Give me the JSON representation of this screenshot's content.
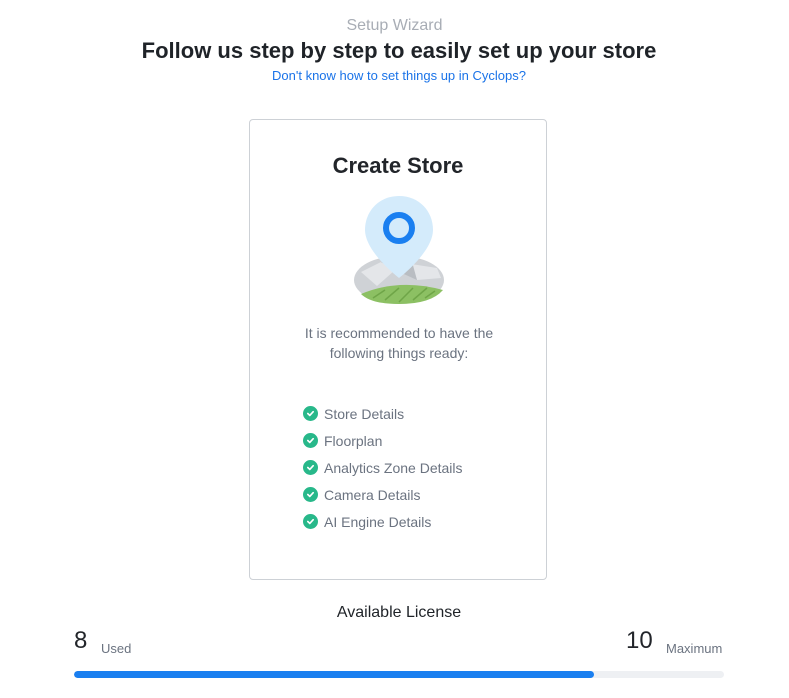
{
  "header": {
    "wizard_label": "Setup Wizard",
    "title": "Follow us step by step to easily set up your store",
    "help_link": "Don't know how to set things up in Cyclops?"
  },
  "card": {
    "title": "Create Store",
    "illustration_icon": "map-pin-icon",
    "recommendation": "It is recommended to have the following things ready:",
    "checklist": [
      "Store Details",
      "Floorplan",
      "Analytics Zone Details",
      "Camera Details",
      "AI Engine Details"
    ]
  },
  "license": {
    "title": "Available License",
    "used": "8",
    "used_label": "Used",
    "maximum": "10",
    "maximum_label": "Maximum",
    "used_fraction": 0.8
  },
  "colors": {
    "accent": "#1a7ff0",
    "check": "#28b88a",
    "link": "#1a73e8"
  }
}
